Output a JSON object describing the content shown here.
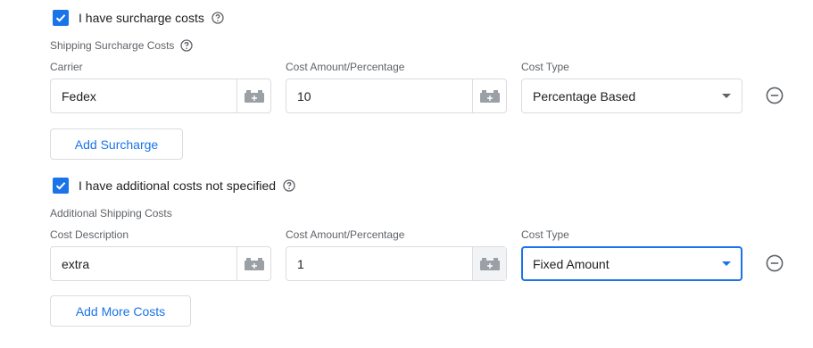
{
  "surcharge": {
    "checkbox_label": "I have surcharge costs",
    "checked": true,
    "section_title": "Shipping Surcharge Costs",
    "labels": {
      "carrier": "Carrier",
      "cost_amount": "Cost Amount/Percentage",
      "cost_type": "Cost Type"
    },
    "row": {
      "carrier": "Fedex",
      "cost_amount": "10",
      "cost_type": "Percentage Based"
    },
    "add_button": "Add Surcharge"
  },
  "additional": {
    "checkbox_label": "I have additional costs not specified",
    "checked": true,
    "section_title": "Additional Shipping Costs",
    "labels": {
      "description": "Cost Description",
      "cost_amount": "Cost Amount/Percentage",
      "cost_type": "Cost Type"
    },
    "row": {
      "description": "extra",
      "cost_amount": "1",
      "cost_type": "Fixed Amount"
    },
    "add_button": "Add More Costs"
  },
  "icons": {
    "help": "help-circle-icon",
    "addon": "variable-insert-icon",
    "remove": "remove-circle-icon",
    "check": "check-icon"
  },
  "colors": {
    "accent": "#1a73e8",
    "border": "#dadce0",
    "label": "#5f6368"
  }
}
